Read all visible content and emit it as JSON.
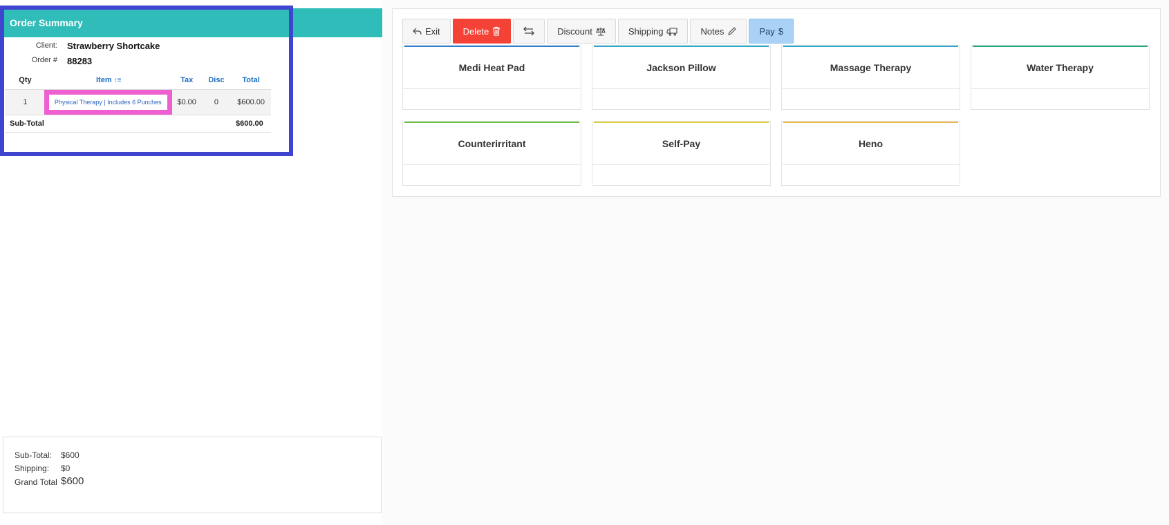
{
  "order_summary": {
    "title": "Order Summary",
    "client_label": "Client:",
    "client_name": "Strawberry Shortcake",
    "order_label": "Order #",
    "order_number": "88283",
    "columns": {
      "qty": "Qty",
      "item": "Item",
      "tax": "Tax",
      "disc": "Disc",
      "total": "Total"
    },
    "items": [
      {
        "qty": "1",
        "item": "Physical Therapy | Includes 6 Punches",
        "tax": "$0.00",
        "disc": "0",
        "total": "$600.00"
      }
    ],
    "subtotal_label": "Sub-Total",
    "subtotal_value": "$600.00"
  },
  "totals": {
    "subtotal_label": "Sub-Total:",
    "subtotal_value": "$600",
    "shipping_label": "Shipping:",
    "shipping_value": "$0",
    "grand_label": "Grand Total",
    "grand_value": "$600"
  },
  "toolbar": {
    "exit": "Exit",
    "delete": "Delete",
    "discount": "Discount",
    "shipping": "Shipping",
    "notes": "Notes",
    "pay": "Pay"
  },
  "products": [
    {
      "name": "Medi Heat Pad",
      "color": "#2a7fd4"
    },
    {
      "name": "Jackson Pillow",
      "color": "#2fa8c9"
    },
    {
      "name": "Massage Therapy",
      "color": "#2fa8c9"
    },
    {
      "name": "Water Therapy",
      "color": "#1fa67a"
    },
    {
      "name": "Counterirritant",
      "color": "#6cbf3f"
    },
    {
      "name": "Self-Pay",
      "color": "#e2cf3e"
    },
    {
      "name": "Heno",
      "color": "#e8b84a"
    }
  ]
}
